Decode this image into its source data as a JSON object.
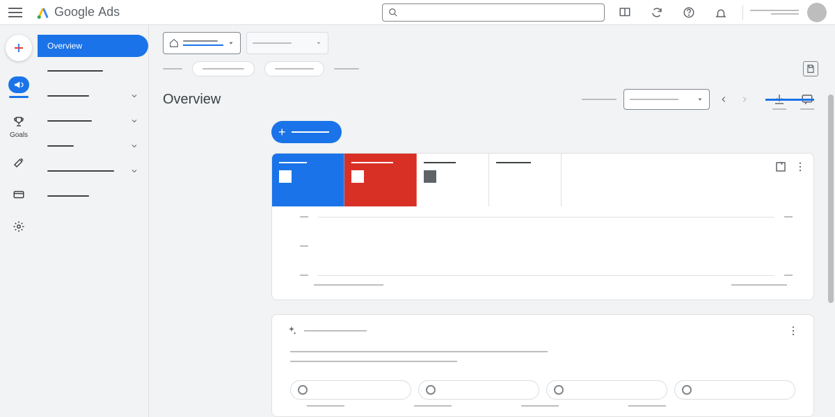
{
  "header": {
    "product_name_1": "Google",
    "product_name_2": "Ads"
  },
  "rail": {
    "goals_label": "Goals"
  },
  "nav": {
    "overview_label": "Overview"
  },
  "page": {
    "title": "Overview"
  },
  "icons": {
    "hamburger": "menu-icon",
    "search": "search-icon",
    "appearance": "appearance-icon",
    "refresh": "refresh-icon",
    "help": "help-icon",
    "notifications": "bell-icon"
  }
}
